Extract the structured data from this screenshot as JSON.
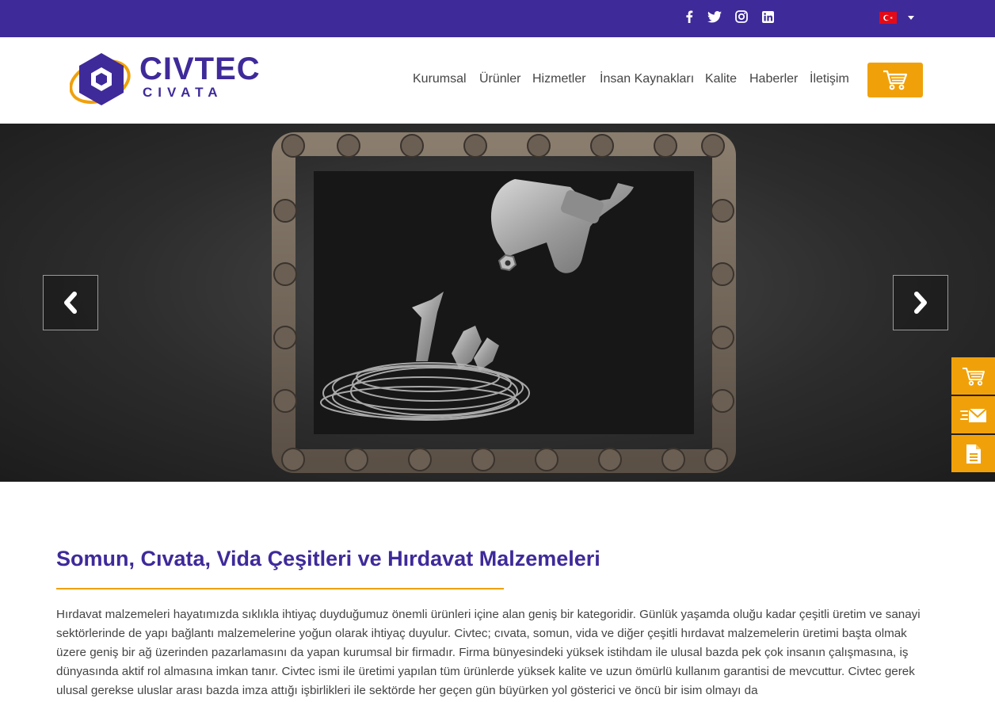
{
  "topbar": {
    "social": [
      {
        "name": "facebook-icon"
      },
      {
        "name": "twitter-icon"
      },
      {
        "name": "instagram-icon"
      },
      {
        "name": "linkedin-icon"
      }
    ],
    "language_flag": "turkey-flag-icon"
  },
  "header": {
    "logo": {
      "line1": "CIVTEC",
      "line2": "CIVATA"
    },
    "nav": [
      "Kurumsal",
      "Ürünler",
      "Hizmetler",
      "İnsan Kaynakları",
      "Kalite",
      "Haberler",
      "İletişim"
    ],
    "cart_icon": "shopping-cart-icon"
  },
  "hero": {
    "prev_icon": "chevron-left-icon",
    "next_icon": "chevron-right-icon"
  },
  "side_buttons": [
    {
      "icon": "cart-icon"
    },
    {
      "icon": "mail-icon"
    },
    {
      "icon": "document-icon"
    }
  ],
  "content": {
    "title": "Somun, Cıvata, Vida Çeşitleri ve Hırdavat Malzemeleri",
    "paragraph": "Hırdavat malzemeleri hayatımızda sıklıkla ihtiyaç duyduğumuz önemli ürünleri içine alan geniş bir kategoridir. Günlük yaşamda oluğu kadar çeşitli üretim ve sanayi sektörlerinde de yapı bağlantı malzemelerine yoğun olarak ihtiyaç duyulur. Civtec; cıvata, somun, vida ve diğer çeşitli hırdavat malzemelerin üretimi başta olmak üzere geniş bir ağ üzerinden pazarlamasını da yapan kurumsal bir firmadır. Firma bünyesindeki yüksek istihdam ile ulusal bazda pek çok insanın çalışmasına, iş dünyasında aktif rol almasına imkan tanır. Civtec ismi ile üretimi yapılan tüm ürünlerde yüksek kalite ve uzun ömürlü kullanım garantisi de mevcuttur. Civtec gerek ulusal gerekse uluslar arası bazda imza attığı işbirlikleri ile sektörde her geçen gün büyürken yol gösterici ve öncü bir isim olmayı da"
  },
  "colors": {
    "primary": "#3f2a9a",
    "accent": "#f0a10a"
  }
}
